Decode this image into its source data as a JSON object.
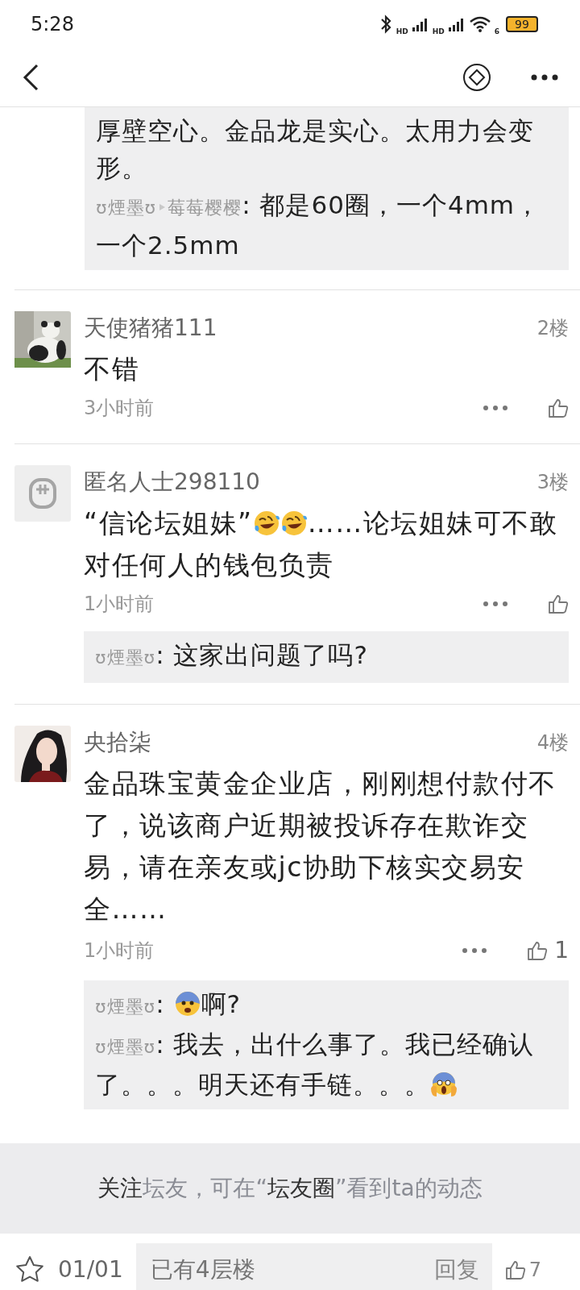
{
  "status_bar": {
    "time": "5:28",
    "signal_labels": [
      "HD",
      "HD"
    ],
    "wifi_label": "6",
    "battery": "99"
  },
  "earlier_replies": [
    {
      "segments": [
        {
          "kind": "text",
          "text": "厚壁空心。金品龙是实心。太用力会变形。"
        }
      ]
    },
    {
      "user": "ʊ煙墨ʊ",
      "target": "莓莓樱樱",
      "segments": [
        {
          "kind": "text",
          "text": ": 都是60圈，一个4mm，一个2.5mm"
        }
      ]
    }
  ],
  "posts": [
    {
      "avatar": {
        "kind": "picture"
      },
      "user": "天使猪猪111",
      "floor": "2楼",
      "body": [
        {
          "kind": "text",
          "text": "不错"
        }
      ],
      "time": "3小时前"
    },
    {
      "avatar": {
        "kind": "icon"
      },
      "user": "匿名人士298110",
      "floor": "3楼",
      "body": [
        {
          "kind": "text",
          "text": "“信论坛姐妹”"
        },
        {
          "kind": "tears"
        },
        {
          "kind": "tears"
        },
        {
          "kind": "text",
          "text": "……论坛姐妹可不敢对任何人的钱包负责"
        }
      ],
      "time": "1小时前",
      "replies": [
        {
          "user": "ʊ煙墨ʊ",
          "segments": [
            {
              "kind": "text",
              "text": ": 这家出问题了吗?"
            }
          ]
        }
      ]
    },
    {
      "avatar": {
        "kind": "picture"
      },
      "user": "央拾柒",
      "floor": "4楼",
      "body": [
        {
          "kind": "text",
          "text": "金品珠宝黄金企业店，刚刚想付款付不了，说该商户近期被投诉存在欺诈交易，请在亲友或jc协助下核实交易安全……"
        }
      ],
      "time": "1小时前",
      "likes": "1",
      "replies": [
        {
          "user": "ʊ煙墨ʊ",
          "segments": [
            {
              "kind": "text",
              "text": ": "
            },
            {
              "kind": "fear"
            },
            {
              "kind": "text",
              "text": "啊?"
            }
          ]
        },
        {
          "user": "ʊ煙墨ʊ",
          "segments": [
            {
              "kind": "text",
              "text": ": 我去，出什么事了。我已经确认了。。。明天还有手链。。。"
            },
            {
              "kind": "scream"
            }
          ]
        }
      ]
    }
  ],
  "follow_tip": "**关注**坛友，可在“**坛友圈**”看到ta的动态",
  "bottom_bar": {
    "starred": false,
    "page": "01/01",
    "placeholder": "已有4层楼",
    "reply_button": "回复",
    "likes": "7"
  }
}
